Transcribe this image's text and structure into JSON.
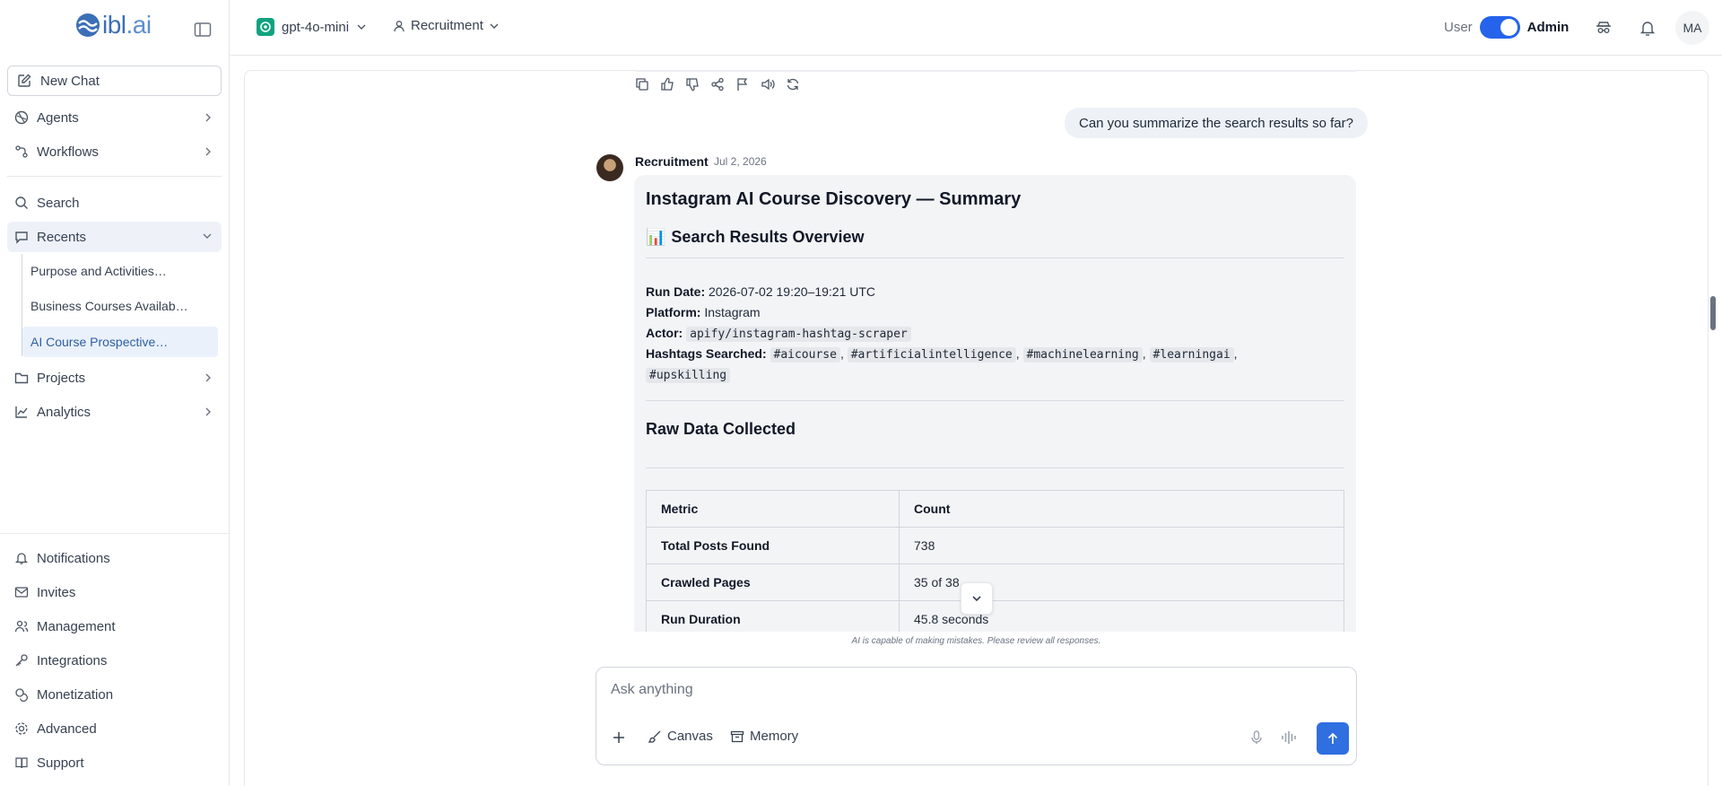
{
  "brand": {
    "logo_text": "ibl",
    "logo_suffix": ".ai"
  },
  "sidebar": {
    "new_chat": "New Chat",
    "agents": "Agents",
    "workflows": "Workflows",
    "search": "Search",
    "recents": "Recents",
    "recent_items": [
      "Purpose and Activities…",
      "Business Courses Availab…",
      "AI Course Prospective…"
    ],
    "projects": "Projects",
    "analytics": "Analytics",
    "bottom": {
      "notifications": "Notifications",
      "invites": "Invites",
      "management": "Management",
      "integrations": "Integrations",
      "monetization": "Monetization",
      "advanced": "Advanced",
      "support": "Support"
    }
  },
  "topbar": {
    "model": "gpt-4o-mini",
    "agent": "Recruitment",
    "role_user": "User",
    "role_admin": "Admin",
    "avatar_initials": "MA",
    "colors": {
      "toggle": "#2563eb",
      "model_icon": "#10a37f"
    }
  },
  "chat": {
    "user_message": "Can you summarize the search results so far?",
    "agent_name": "Recruitment",
    "agent_date": "Jul 2, 2026",
    "response": {
      "title": "Instagram AI Course Discovery — Summary",
      "overview_heading": "Search Results Overview",
      "overview_emoji": "📊",
      "run_date_label": "Run Date:",
      "run_date_value": "2026-07-02 19:20–19:21 UTC",
      "platform_label": "Platform:",
      "platform_value": "Instagram",
      "actor_label": "Actor:",
      "actor_value": "apify/instagram-hashtag-scraper",
      "hashtags_label": "Hashtags Searched:",
      "hashtags": [
        "#aicourse",
        "#artificialintelligence",
        "#machinelearning",
        "#learningai",
        "#upskilling"
      ],
      "raw_heading": "Raw Data Collected",
      "table": {
        "headers": [
          "Metric",
          "Count"
        ],
        "rows": [
          [
            "Total Posts Found",
            "738"
          ],
          [
            "Crawled Pages",
            "35 of 38"
          ],
          [
            "Run Duration",
            "45.8 seconds"
          ]
        ]
      }
    },
    "disclaimer": "AI is capable of making mistakes. Please review all responses."
  },
  "composer": {
    "placeholder": "Ask anything",
    "canvas_label": "Canvas",
    "memory_label": "Memory",
    "send_color": "#2f6fe0"
  }
}
